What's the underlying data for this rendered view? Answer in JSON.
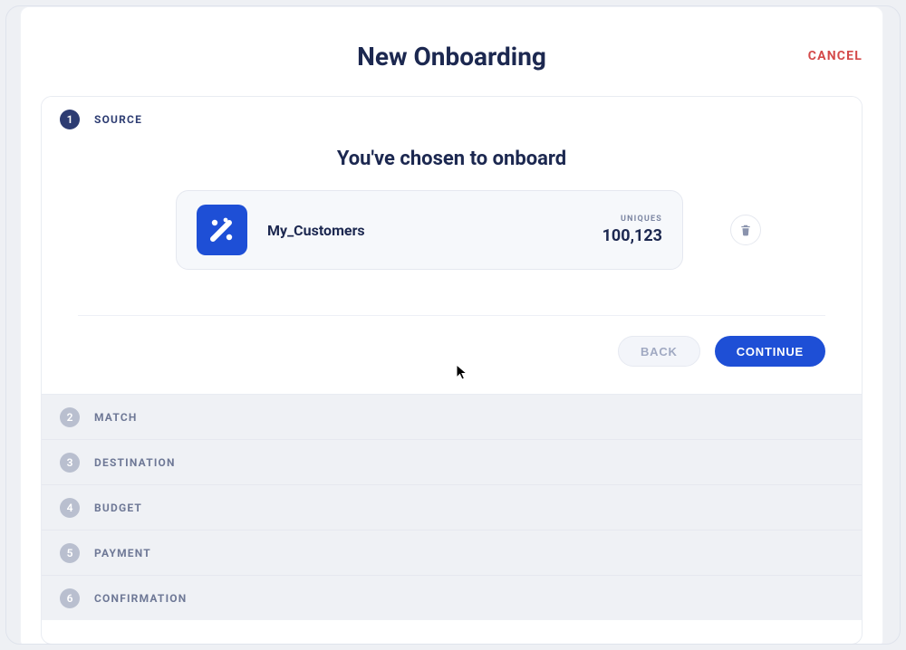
{
  "header": {
    "title": "New Onboarding",
    "cancel": "CANCEL"
  },
  "steps": [
    {
      "num": "1",
      "label": "SOURCE"
    },
    {
      "num": "2",
      "label": "MATCH"
    },
    {
      "num": "3",
      "label": "DESTINATION"
    },
    {
      "num": "4",
      "label": "BUDGET"
    },
    {
      "num": "5",
      "label": "PAYMENT"
    },
    {
      "num": "6",
      "label": "CONFIRMATION"
    }
  ],
  "source_step": {
    "chosen_text": "You've chosen to onboard",
    "source": {
      "name": "My_Customers",
      "uniques_label": "UNIQUES",
      "uniques_value": "100,123"
    }
  },
  "actions": {
    "back": "BACK",
    "continue": "CONTINUE"
  },
  "colors": {
    "accent": "#1e4fd6",
    "dark": "#1c2850",
    "danger": "#d44a4a"
  }
}
